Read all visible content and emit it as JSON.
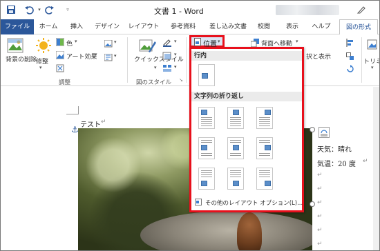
{
  "window": {
    "title": "文書 1 - Word"
  },
  "tabs": [
    {
      "label": "ファイル"
    },
    {
      "label": "ホーム"
    },
    {
      "label": "挿入"
    },
    {
      "label": "デザイン"
    },
    {
      "label": "レイアウト"
    },
    {
      "label": "参考資料"
    },
    {
      "label": "差し込み文書"
    },
    {
      "label": "校閲"
    },
    {
      "label": "表示"
    },
    {
      "label": "ヘルプ"
    },
    {
      "label": "図の形式"
    }
  ],
  "ribbon": {
    "remove_bg": "背景の削除",
    "correct": "修整",
    "color": "色",
    "art_effect": "アート効果",
    "quick_style": "クイックスタイル",
    "adjust_group": "調整",
    "picture_style_group": "図のスタイル",
    "position_btn": "位置",
    "send_back": "背面へ移動",
    "select_show": "択と表示",
    "trim": "トリミ"
  },
  "dropdown": {
    "inline_header": "行内",
    "wrap_header": "文字列の折り返し",
    "more_options": "その他のレイアウト オプション(L)..."
  },
  "document": {
    "test_text": "テスト",
    "weather": "天気：晴れ",
    "temperature": "気温：20 度"
  },
  "colors": {
    "accent": "#2b579a",
    "highlight": "#e8101c"
  }
}
